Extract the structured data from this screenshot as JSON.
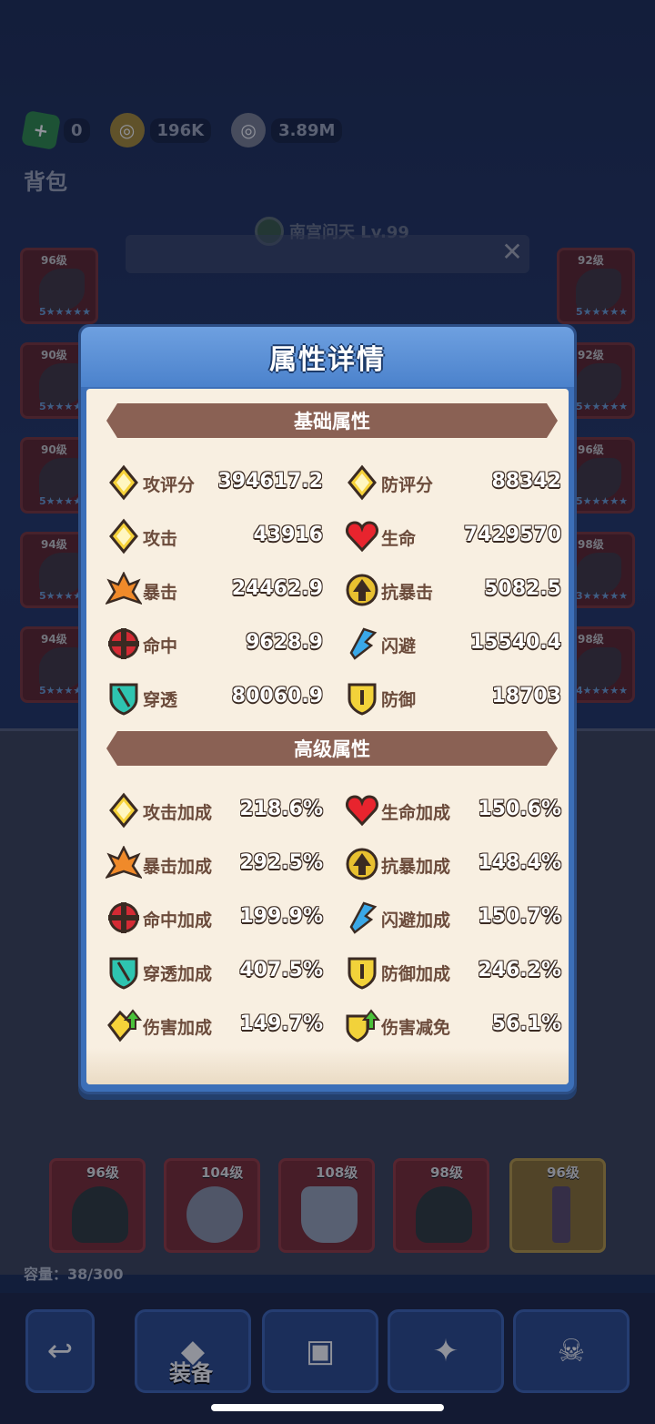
{
  "currencies": [
    {
      "icon": "green-gem-icon",
      "value": "0"
    },
    {
      "icon": "gold-coin-icon",
      "value": "196K"
    },
    {
      "icon": "silver-coin-icon",
      "value": "3.89M"
    }
  ],
  "bag_title": "背包",
  "character": {
    "name": "南宫问天 Lv.99"
  },
  "left_slots": [
    {
      "level": "96级",
      "stars": "5★★★★★"
    },
    {
      "level": "90级",
      "stars": "5★★★★★"
    },
    {
      "level": "90级",
      "stars": "5★★★★★"
    },
    {
      "level": "94级",
      "stars": "5★★★★★"
    },
    {
      "level": "94级",
      "stars": "5★★★★★"
    }
  ],
  "right_slots": [
    {
      "level": "92级",
      "stars": "5★★★★★"
    },
    {
      "level": "92级",
      "stars": "5★★★★★"
    },
    {
      "level": "96级",
      "stars": "5★★★★★"
    },
    {
      "level": "98级",
      "stars": "3★★★★★"
    },
    {
      "level": "98级",
      "stars": "4★★★★★"
    }
  ],
  "modal": {
    "title": "属性详情",
    "basic_title": "基础属性",
    "advanced_title": "高级属性",
    "basic": [
      {
        "icon": "attack-score-icon",
        "label": "攻评分",
        "value": "394617.2"
      },
      {
        "icon": "defense-score-icon",
        "label": "防评分",
        "value": "88342"
      },
      {
        "icon": "attack-icon",
        "label": "攻击",
        "value": "43916"
      },
      {
        "icon": "heart-icon",
        "label": "生命",
        "value": "7429570"
      },
      {
        "icon": "crit-icon",
        "label": "暴击",
        "value": "24462.9"
      },
      {
        "icon": "anti-crit-icon",
        "label": "抗暴击",
        "value": "5082.5"
      },
      {
        "icon": "hit-icon",
        "label": "命中",
        "value": "9628.9"
      },
      {
        "icon": "dodge-icon",
        "label": "闪避",
        "value": "15540.4"
      },
      {
        "icon": "pierce-icon",
        "label": "穿透",
        "value": "80060.9"
      },
      {
        "icon": "defense-icon",
        "label": "防御",
        "value": "18703"
      }
    ],
    "advanced": [
      {
        "icon": "attack-icon",
        "label": "攻击加成",
        "value": "218.6%"
      },
      {
        "icon": "heart-icon",
        "label": "生命加成",
        "value": "150.6%"
      },
      {
        "icon": "crit-icon",
        "label": "暴击加成",
        "value": "292.5%"
      },
      {
        "icon": "anti-crit-icon",
        "label": "抗暴加成",
        "value": "148.4%"
      },
      {
        "icon": "hit-icon",
        "label": "命中加成",
        "value": "199.9%"
      },
      {
        "icon": "dodge-icon",
        "label": "闪避加成",
        "value": "150.7%"
      },
      {
        "icon": "pierce-icon",
        "label": "穿透加成",
        "value": "407.5%"
      },
      {
        "icon": "defense-icon",
        "label": "防御加成",
        "value": "246.2%"
      },
      {
        "icon": "damage-boost-icon",
        "label": "伤害加成",
        "value": "149.7%"
      },
      {
        "icon": "damage-reduction-icon",
        "label": "伤害减免",
        "value": "56.1%"
      }
    ]
  },
  "bottom_row": [
    {
      "level": "96级",
      "type": "helm"
    },
    {
      "level": "104级",
      "type": "ring"
    },
    {
      "level": "108级",
      "type": "shield"
    },
    {
      "level": "98级",
      "type": "helm"
    },
    {
      "level": "96级",
      "type": "staff"
    }
  ],
  "capacity": "容量：38/300",
  "nav": {
    "equip_label": "装备"
  }
}
